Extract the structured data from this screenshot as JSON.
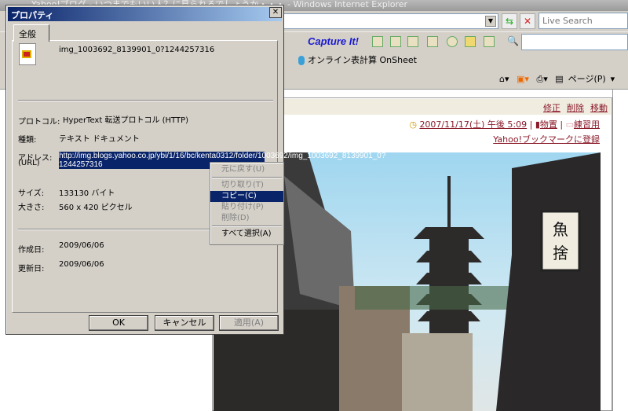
{
  "browser": {
    "window_title": "Yahoo!ブログ - いつまでもいい人？に見られるでしょうか・・・ - Windows Internet Explorer",
    "search_placeholder": "Live Search",
    "toolbar": {
      "capture_label": "Capture It!",
      "links_item": "オンライン表計算 OnSheet",
      "page_menu": "ページ(P)"
    },
    "icons": [
      "refresh-icon",
      "stop-icon",
      "home-icon",
      "rss-icon",
      "print-icon",
      "page-icon",
      "search-icon"
    ]
  },
  "blog": {
    "edit": "修正",
    "delete": "削除",
    "move": "移動",
    "date": "2007/11/17(土) 午後 5:09",
    "category1": "物置",
    "category2": "練習用",
    "bookmark": "Yahoo!ブックマークに登録"
  },
  "dialog": {
    "title": "プロパティ",
    "tab": "全般",
    "filename": "img_1003692_8139901_0?1244257316",
    "protocol_label": "プロトコル:",
    "protocol": "HyperText 転送プロトコル (HTTP)",
    "type_label": "種類:",
    "type": "テキスト ドキュメント",
    "address_label": "アドレス:",
    "address_label2": "(URL)",
    "address": "http://img.blogs.yahoo.co.jp/ybi/1/16/bc/kenta0312/folder/1003692/img_1003692_8139901_0?1244257316",
    "size_label": "サイズ:",
    "size": "133130 バイト",
    "dims_label": "大きさ:",
    "dims": "560 x 420 ピクセル",
    "created_label": "作成日:",
    "created": "2009/06/06",
    "modified_label": "更新日:",
    "modified": "2009/06/06",
    "ok": "OK",
    "cancel": "キャンセル",
    "apply": "適用(A)"
  },
  "context_menu": {
    "items": [
      {
        "label": "元に戻す(U)",
        "enabled": false
      },
      {
        "label": "切り取り(T)",
        "enabled": false
      },
      {
        "label": "コピー(C)",
        "enabled": true,
        "selected": true
      },
      {
        "label": "貼り付け(P)",
        "enabled": false
      },
      {
        "label": "削除(D)",
        "enabled": false
      },
      {
        "label": "すべて選択(A)",
        "enabled": true
      }
    ]
  },
  "photo_sign": "魚 捨"
}
